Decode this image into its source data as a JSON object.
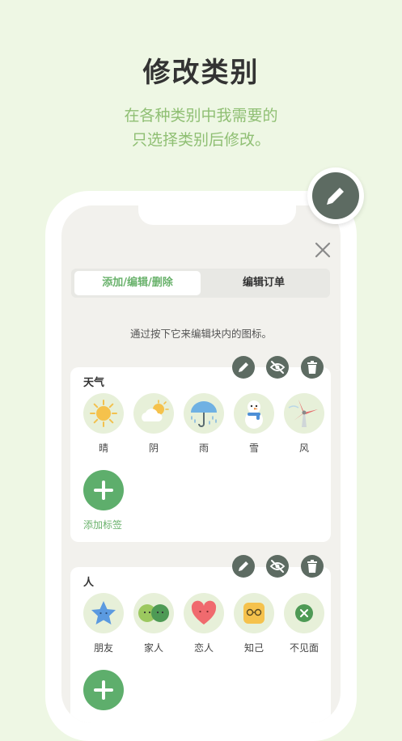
{
  "promo": {
    "title": "修改类别",
    "subtitle_line1": "在各种类别中我需要的",
    "subtitle_line2": "只选择类别后修改。"
  },
  "tabs": [
    {
      "label": "添加/编辑/删除",
      "active": true
    },
    {
      "label": "编辑订单",
      "active": false
    }
  ],
  "hint": "通过按下它来编辑块内的图标。",
  "categories": [
    {
      "title": "天气",
      "add_label": "添加标签",
      "items": [
        {
          "label": "晴",
          "icon": "sun-icon"
        },
        {
          "label": "阴",
          "icon": "cloud-sun-icon"
        },
        {
          "label": "雨",
          "icon": "umbrella-rain-icon"
        },
        {
          "label": "雪",
          "icon": "snowman-icon"
        },
        {
          "label": "风",
          "icon": "windmill-icon"
        }
      ]
    },
    {
      "title": "人",
      "items": [
        {
          "label": "朋友",
          "icon": "star-face-icon"
        },
        {
          "label": "家人",
          "icon": "two-faces-icon"
        },
        {
          "label": "恋人",
          "icon": "heart-face-icon"
        },
        {
          "label": "知己",
          "icon": "glasses-face-icon"
        },
        {
          "label": "不见面",
          "icon": "x-circle-icon"
        }
      ]
    }
  ],
  "colors": {
    "background": "#eef7e4",
    "accent_green": "#6ab26c",
    "dark_button": "#5d6b62",
    "chip_bg": "#e7f0d9"
  }
}
